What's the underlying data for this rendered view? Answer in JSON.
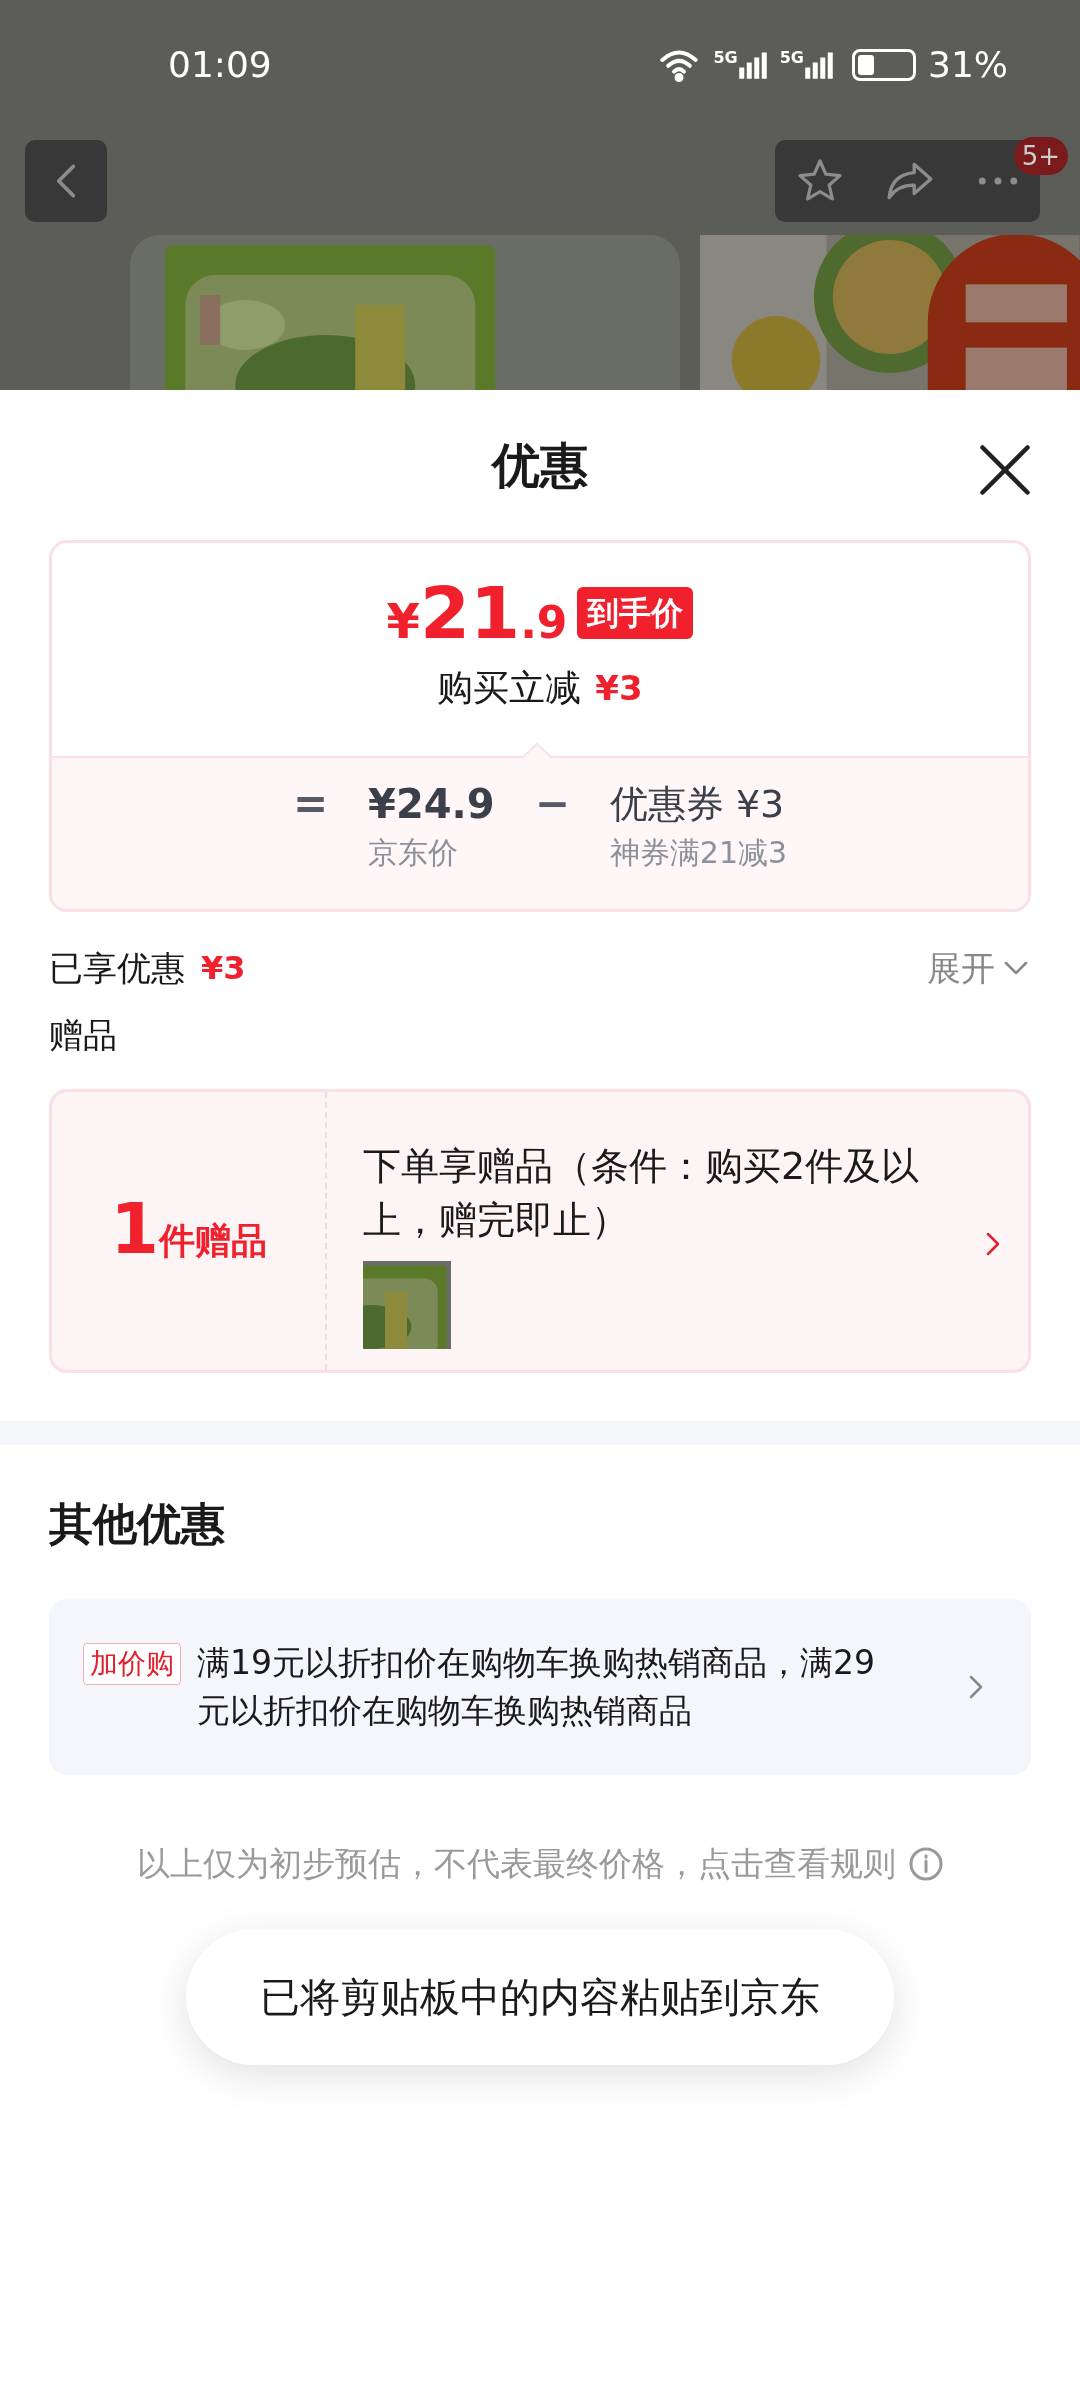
{
  "status_bar": {
    "time": "01:09",
    "signal_labels": [
      "5G",
      "5G"
    ],
    "battery": "31%"
  },
  "nav": {
    "badge": "5+"
  },
  "sheet": {
    "title": "优惠"
  },
  "price_card": {
    "final_symbol": "¥",
    "final_integer": "21",
    "final_decimal": ".9",
    "final_tag": "到手价",
    "instant_label": "购买立减",
    "instant_amount": "¥3",
    "equals": "=",
    "base_price": "¥24.9",
    "base_label": "京东价",
    "minus": "−",
    "coupon_title": "优惠券 ¥3",
    "coupon_note": "神券满21减3"
  },
  "enjoyed": {
    "label": "已享优惠",
    "amount": "¥3",
    "expand": "展开",
    "expanded": false
  },
  "gifts": {
    "heading": "赠品",
    "count": "1",
    "count_unit": "件赠品",
    "description": "下单享赠品（条件：购买2件及以上，赠完即止）"
  },
  "other": {
    "heading": "其他优惠",
    "items": [
      {
        "tag": "加价购",
        "text": "满19元以折扣价在购物车换购热销商品，满29元以折扣价在购物车换购热销商品"
      }
    ]
  },
  "footnote": "以上仅为初步预估，不代表最终价格，点击查看规则",
  "toast": "已将剪贴板中的内容粘贴到京东"
}
